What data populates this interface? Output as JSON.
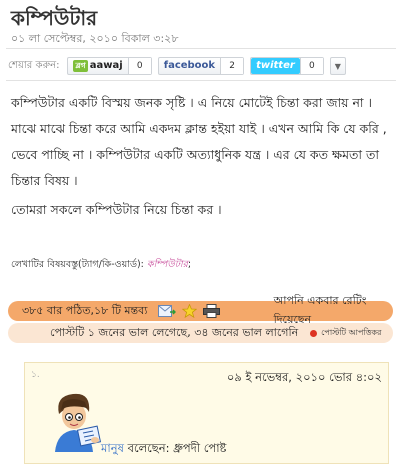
{
  "post": {
    "title": "কম্পিউটার",
    "date": "০১ লা সেপ্টেম্বর, ২০১০ বিকাল ৩:২৮"
  },
  "share": {
    "label": "শেয়ার করুন:",
    "aawaj_badge": "ব্লগ",
    "aawaj_label": "aawaj",
    "aawaj_count": "0",
    "facebook_label": "facebook",
    "facebook_count": "2",
    "twitter_label": "twitter",
    "twitter_count": "0"
  },
  "body": {
    "paragraph1": "কম্পিউটার একটি বিস্ময় জনক সৃষ্টি । এ নিয়ে মোটেই চিন্তা করা জায় না । মাঝে মাঝে চিন্তা করে আমি একদম ক্লান্ত হইয়া যাই । এখন আমি কি যে করি , ভেবে পাচ্ছি না । কম্পিউটার একটি অত্যাধুনিক যন্ত্র । এর যে কত ক্ষমতা তা চিন্তার বিষয় ।",
    "paragraph2": "তোমরা সকলে কম্পিউটার নিয়ে চিন্তা কর ।"
  },
  "tags": {
    "label": "লেখাটির বিষয়বস্তু(ট্যাগ/কি-ওয়ার্ড):",
    "value": "কম্পিউটার",
    "suffix": ";"
  },
  "stats": {
    "reads_comments": "৩৮৫ বার পঠিত,১৮ টি মন্তব্য",
    "rating": "আপনি একবার রেটিং দিয়েছেন",
    "likes": "পোস্টটি ১ জনের ভাল লেগেছে, ৩৪ জনের ভাল লাগেনি",
    "notify": "পোস্টটি আপত্তিকর"
  },
  "comment": {
    "number": "১.",
    "time": "০৯ ই নভেম্বর, ২০১০ ভোর ৪:০২",
    "author": "মানুষ",
    "says": "বলেছেন: ধ্রুপদী পোষ্ট"
  }
}
